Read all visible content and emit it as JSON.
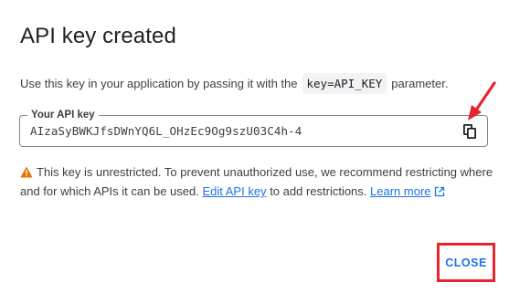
{
  "dialog": {
    "title": "API key created",
    "description_prefix": "Use this key in your application by passing it with the",
    "description_code": "key=API_KEY",
    "description_suffix": "parameter.",
    "key_field": {
      "label": "Your API key",
      "value": "AIzaSyBWKJfsDWnYQ6L_OHzEc9Og9szU03C4h-4",
      "copy_icon": "copy-icon"
    },
    "warning": {
      "icon": "warning-icon",
      "text_before_link": "This key is unrestricted. To prevent unauthorized use, we recommend restricting where and for which APIs it can be used.",
      "edit_link": "Edit API key",
      "text_after_link": "to add restrictions.",
      "learn_more_link": "Learn more",
      "external_icon": "open-in-new-icon"
    },
    "close_label": "CLOSE"
  },
  "colors": {
    "accent": "#1a73e8",
    "warning": "#e37400",
    "annotation": "#e8232b",
    "text": "#202124"
  }
}
